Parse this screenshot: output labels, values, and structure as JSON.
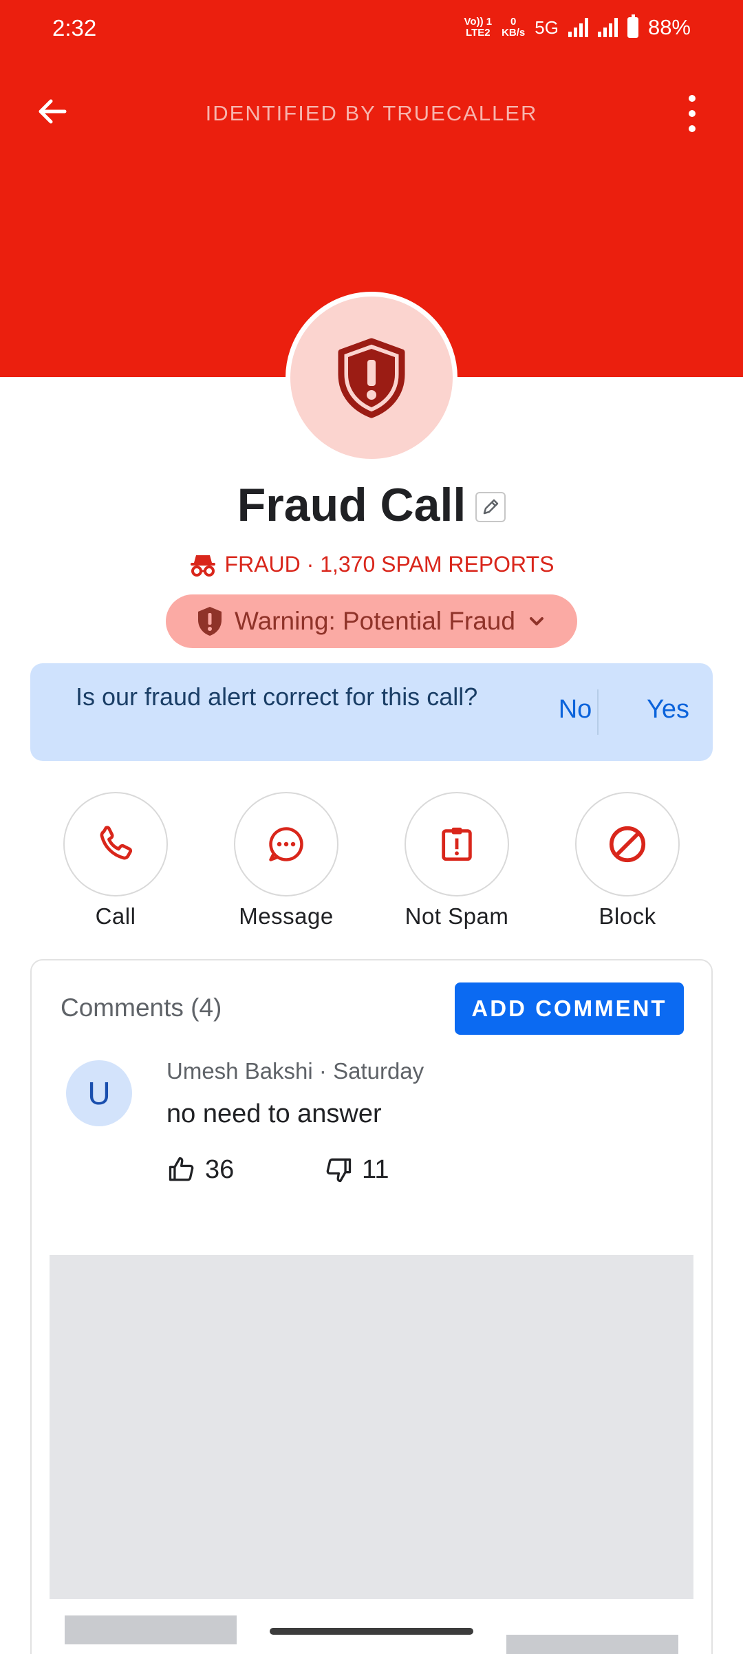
{
  "status_bar": {
    "time": "2:32",
    "volte_line1": "Vo)) 1",
    "volte_line2": "LTE2",
    "net_speed_value": "0",
    "net_speed_unit": "KB/s",
    "network": "5G",
    "battery": "88%"
  },
  "toolbar": {
    "title": "IDENTIFIED BY TRUECALLER",
    "back_icon": "arrow-left-icon",
    "more_icon": "more-vertical-icon"
  },
  "caller": {
    "name": "Fraud Call",
    "fraud_label": "FRAUD · 1,370 SPAM REPORTS",
    "warning": "Warning: Potential Fraud"
  },
  "fraud_alert": {
    "question": "Is our fraud alert correct for this call?",
    "no_label": "No",
    "yes_label": "Yes"
  },
  "actions": [
    {
      "label": "Call",
      "icon": "phone-icon"
    },
    {
      "label": "Message",
      "icon": "message-icon"
    },
    {
      "label": "Not Spam",
      "icon": "not-spam-icon"
    },
    {
      "label": "Block",
      "icon": "block-icon"
    }
  ],
  "comments": {
    "title": "Comments (4)",
    "add_label": "ADD COMMENT",
    "items": [
      {
        "avatar_letter": "U",
        "meta": "Umesh Bakshi · Saturday",
        "text": "no need to answer",
        "likes": "36",
        "dislikes": "11"
      }
    ]
  },
  "colors": {
    "header_red": "#eb1f0e",
    "fraud_red": "#d9261b",
    "warning_chip": "#fbaaa4",
    "alert_blue_bg": "#cfe2fd",
    "link_blue": "#0b63db",
    "button_blue": "#0b6af2"
  }
}
